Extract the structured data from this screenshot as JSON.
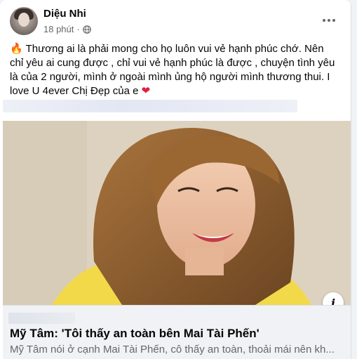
{
  "post": {
    "author": "Diệu Nhi",
    "time": "18 phút",
    "privacy_icon": "globe-icon",
    "text_emoji": "🔥",
    "text": "Thương ai là phải mong cho họ luôn vui vẻ hạnh phúc chớ. Nên chỉ yêu ai cung được , chỉ vui vẻ hạnh phúc là được , chuyện tình yêu là của 2 người, mình ở ngoài mình ủng hộ người mình thương thui. I love U 4ever Chị Đẹp của e",
    "text_end_emoji": "❤"
  },
  "link": {
    "title": "Mỹ Tâm: 'Tôi thấy an toàn bên Mai Tài Phến'",
    "description": "Mỹ Tâm nói ở cạnh Mai Tài Phến, cô thấy an toàn, thoải mái nên kh...",
    "info_label": "i"
  },
  "colors": {
    "accent": "#e41e3f",
    "secondary_text": "#65676b",
    "preview_bg": "#f0f2f5"
  }
}
